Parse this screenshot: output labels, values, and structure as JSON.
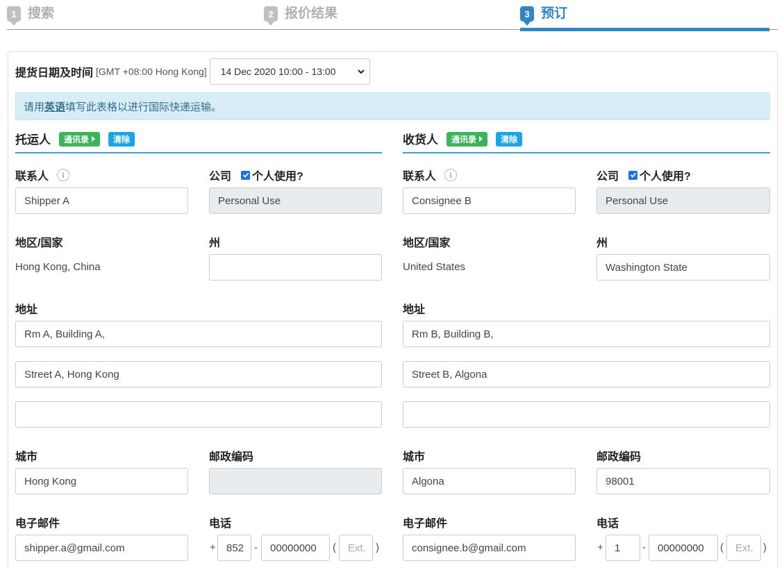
{
  "steps": [
    {
      "num": "1",
      "label": "搜索"
    },
    {
      "num": "2",
      "label": "报价结果"
    },
    {
      "num": "3",
      "label": "预订"
    }
  ],
  "pickup": {
    "label": "提货日期及时间",
    "timezone": "[GMT +08:00 Hong Kong]",
    "selected": "14 Dec 2020 10:00 - 13:00"
  },
  "notice": {
    "prefix": "请用",
    "emph": "英语",
    "suffix": "填写此表格以进行国际快递运输。"
  },
  "shipper": {
    "title": "托运人",
    "book_label": "通讯录",
    "clear_label": "清除",
    "contact_label": "联系人",
    "company_label": "公司",
    "personal_label": "个人使用?",
    "contact": "Shipper A",
    "company": "Personal Use",
    "country_label": "地区/国家",
    "country": "Hong Kong, China",
    "state_label": "州",
    "state": "",
    "address_label": "地址",
    "address1": "Rm A, Building A,",
    "address2": "Street A, Hong Kong",
    "address3": "",
    "city_label": "城市",
    "city": "Hong Kong",
    "zip_label": "邮政编码",
    "zip": "",
    "email_label": "电子邮件",
    "email": "shipper.a@gmail.com",
    "phone_label": "电话",
    "phone_code": "852",
    "phone_number": "00000000",
    "ext_placeholder": "Ext."
  },
  "consignee": {
    "title": "收货人",
    "book_label": "通讯录",
    "clear_label": "清除",
    "contact_label": "联系人",
    "company_label": "公司",
    "personal_label": "个人使用?",
    "contact": "Consignee B",
    "company": "Personal Use",
    "country_label": "地区/国家",
    "country": "United States",
    "state_label": "州",
    "state": "Washington State",
    "address_label": "地址",
    "address1": "Rm B, Building B,",
    "address2": "Street B, Algona",
    "address3": "",
    "city_label": "城市",
    "city": "Algona",
    "zip_label": "邮政编码",
    "zip": "98001",
    "email_label": "电子邮件",
    "email": "consignee.b@gmail.com",
    "phone_label": "电话",
    "phone_code": "1",
    "phone_number": "00000000",
    "ext_placeholder": "Ext."
  },
  "phone_symbols": {
    "plus": "+",
    "dash": "-",
    "open": "(",
    "close": ")"
  },
  "colors": {
    "accent": "#2f86c6",
    "green": "#3cb45a",
    "cyan": "#1ba5e8",
    "notice_bg": "#d9edf7"
  }
}
